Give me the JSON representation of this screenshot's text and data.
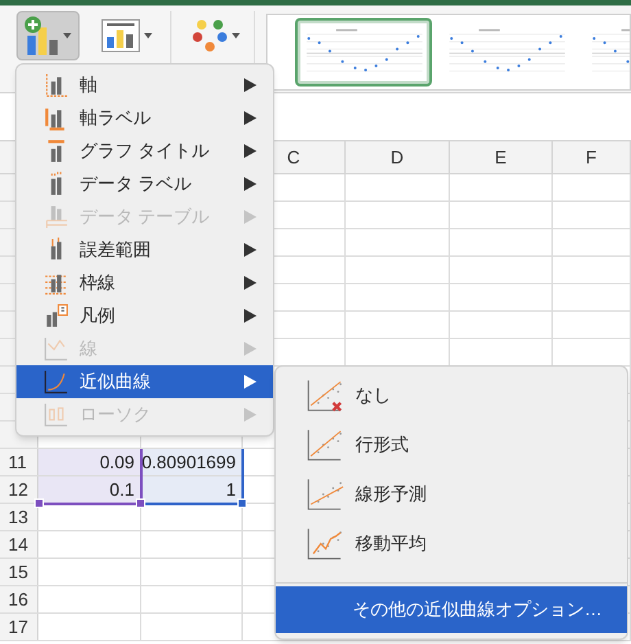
{
  "chart_styles": [
    {
      "selected": true
    },
    {
      "selected": false
    },
    {
      "selected": false
    }
  ],
  "columns": [
    "C",
    "D",
    "E",
    "F"
  ],
  "rows": [
    {
      "number": "11",
      "cells": [
        "0.09",
        "0.80901699"
      ]
    },
    {
      "number": "12",
      "cells": [
        "0.1",
        "1"
      ]
    },
    {
      "number": "13"
    },
    {
      "number": "14"
    },
    {
      "number": "15"
    },
    {
      "number": "16"
    },
    {
      "number": "17"
    }
  ],
  "menu": {
    "items": [
      {
        "kind": "axes",
        "label": "軸",
        "disabled": false,
        "selected": false
      },
      {
        "kind": "axis-titles",
        "label": "軸ラベル",
        "disabled": false,
        "selected": false
      },
      {
        "kind": "chart-title",
        "label": "グラフ タイトル",
        "disabled": false,
        "selected": false
      },
      {
        "kind": "data-labels",
        "label": "データ ラベル",
        "disabled": false,
        "selected": false
      },
      {
        "kind": "data-table",
        "label": "データ テーブル",
        "disabled": true,
        "selected": false
      },
      {
        "kind": "error-bars",
        "label": "誤差範囲",
        "disabled": false,
        "selected": false
      },
      {
        "kind": "gridlines",
        "label": "枠線",
        "disabled": false,
        "selected": false
      },
      {
        "kind": "legend",
        "label": "凡例",
        "disabled": false,
        "selected": false
      },
      {
        "kind": "lines",
        "label": "線",
        "disabled": true,
        "selected": false
      },
      {
        "kind": "trendline",
        "label": "近似曲線",
        "disabled": false,
        "selected": true
      },
      {
        "kind": "up-down-bars",
        "label": "ローソク",
        "disabled": true,
        "selected": false
      }
    ]
  },
  "submenu": {
    "items": [
      {
        "kind": "none",
        "label": "なし"
      },
      {
        "kind": "exponential",
        "label": "行形式"
      },
      {
        "kind": "forecast",
        "label": "線形予測"
      },
      {
        "kind": "moving-average",
        "label": "移動平均"
      }
    ],
    "more": {
      "label": "その他の近似曲線オプション…",
      "selected": true
    }
  }
}
